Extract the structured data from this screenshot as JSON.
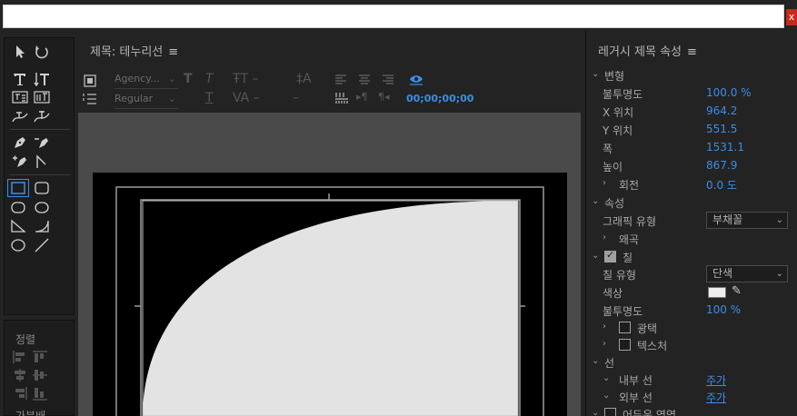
{
  "close_glyph": "x",
  "title_panel": {
    "title": "제목: 테누리선",
    "menu_icon": "≡",
    "font_family": "Agency...",
    "font_style": "Regular",
    "timecode": "00;00;00;00"
  },
  "align_panel": {
    "label": "정렬",
    "label2": "가분배"
  },
  "props": {
    "title": "레거시 제목 속성",
    "menu_icon": "≡",
    "transform": {
      "header": "변형",
      "opacity_label": "불투명도",
      "opacity_value": "100.0 %",
      "x_label": "X 위치",
      "x_value": "964.2",
      "y_label": "Y 위치",
      "y_value": "551.5",
      "width_label": "폭",
      "width_value": "1531.1",
      "height_label": "높이",
      "height_value": "867.9",
      "rotation_label": "회전",
      "rotation_value": "0.0 도"
    },
    "properties": {
      "header": "속성",
      "graphic_type_label": "그래픽 유형",
      "graphic_type_value": "부채꼴",
      "distort_label": "왜곡"
    },
    "fill": {
      "header": "칠",
      "fill_type_label": "칠 유형",
      "fill_type_value": "단색",
      "color_label": "색상",
      "color_hex": "#eeeeee",
      "opacity_label": "불투명도",
      "opacity_value": "100 %",
      "sheen_label": "광택",
      "texture_label": "텍스처"
    },
    "stroke": {
      "header": "선",
      "inner_label": "내부 선",
      "inner_value": "주가",
      "outer_label": "외부 선",
      "outer_value": "주가",
      "shadow_label": "어두운 영역"
    }
  },
  "colors": {
    "accent": "#3a8ee6",
    "shape_fill": "#e3e3e3"
  }
}
